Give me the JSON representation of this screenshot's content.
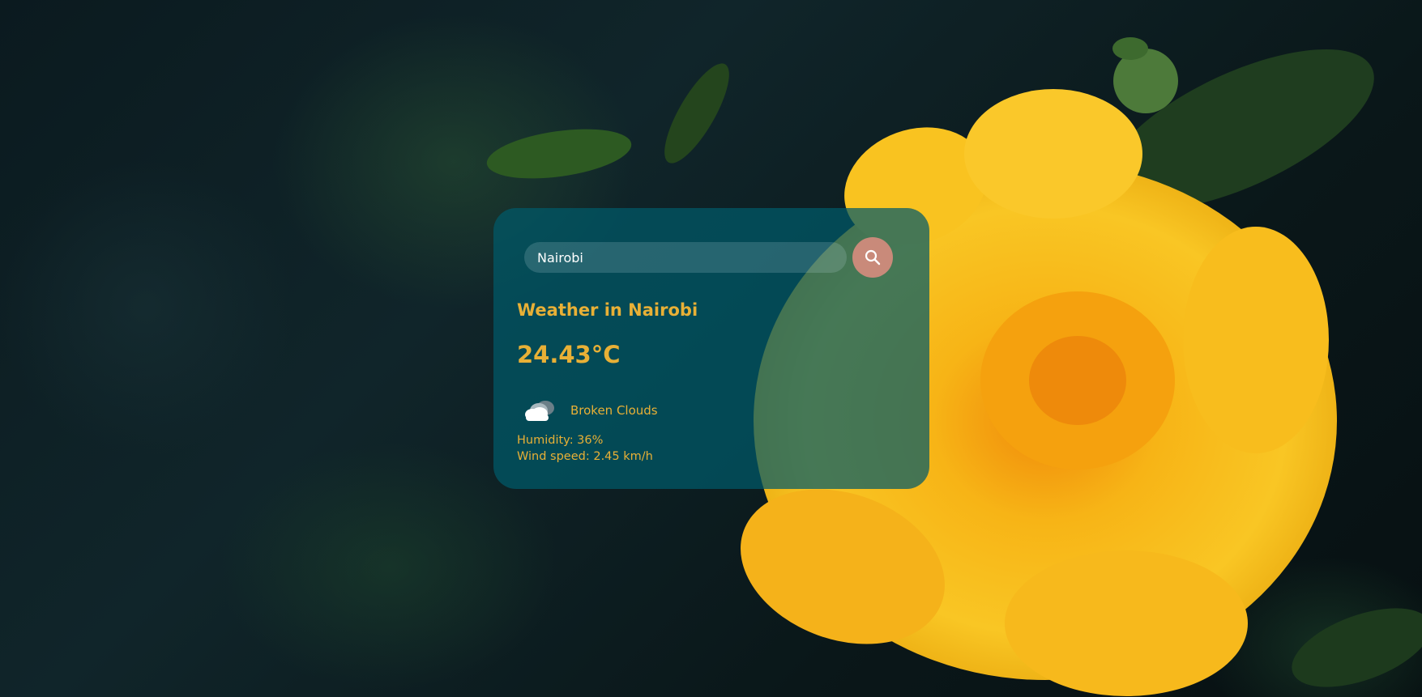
{
  "search": {
    "value": "Nairobi",
    "button_icon": "search-icon"
  },
  "weather": {
    "title": "Weather in Nairobi",
    "temperature": "24.43°C",
    "condition_icon": "broken-clouds-icon",
    "condition": "Broken Clouds",
    "humidity": "Humidity: 36%",
    "wind": "Wind speed: 2.45 km/h"
  },
  "colors": {
    "accent": "#e8b036",
    "card_background": "#005a69",
    "search_button": "#c98a7a"
  }
}
